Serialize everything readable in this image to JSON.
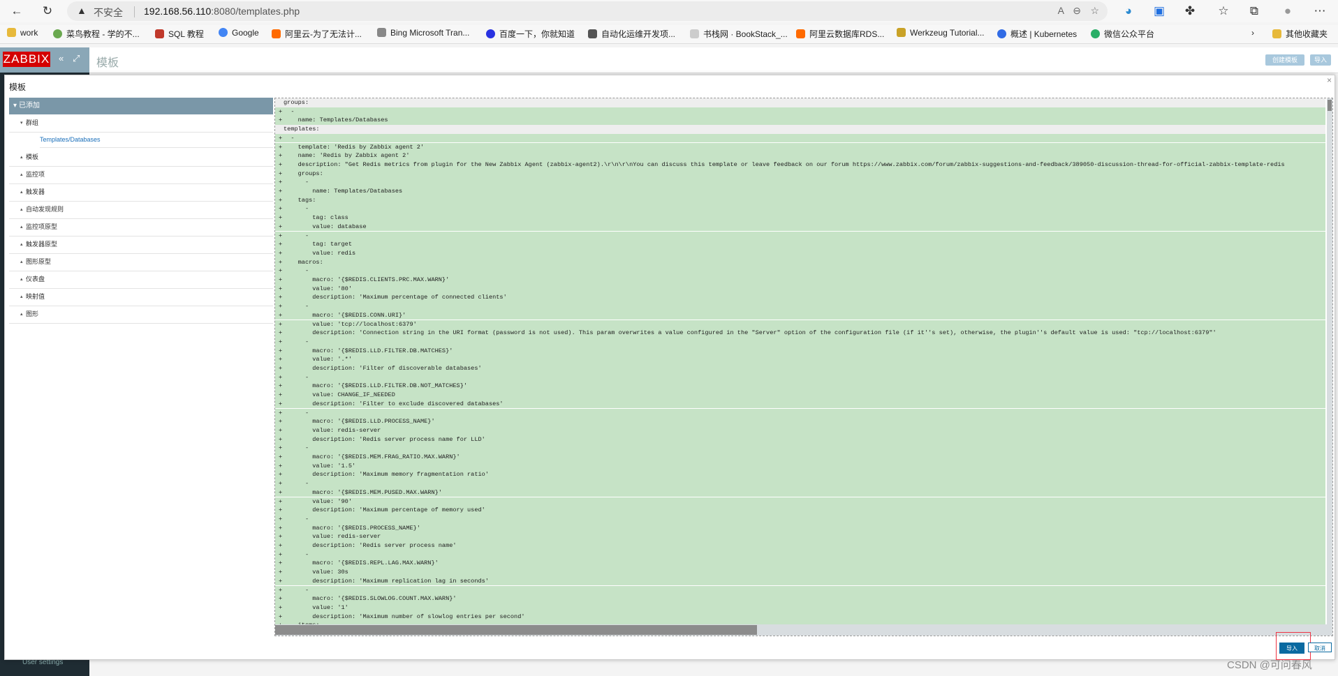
{
  "browser": {
    "security_text": "不安全",
    "url_host": "192.168.56.110",
    "url_rest": ":8080/templates.php",
    "bookmarks": [
      "work",
      "菜鸟教程 - 学的不...",
      "SQL 教程",
      "Google",
      "阿里云-为了无法计...",
      "Bing Microsoft Tran...",
      "百度一下，你就知道",
      "自动化运维开发项...",
      "书栈网 · BookStack_...",
      "阿里云数据库RDS...",
      "Werkzeug Tutorial...",
      "概述 | Kubernetes",
      "微信公众平台"
    ],
    "other_bookmarks": "其他收藏夹",
    "colors": {
      "chrome_bg": "#f7f7f7",
      "addr_bg": "#ececec"
    }
  },
  "app": {
    "logo": "ZABBIX",
    "page_title": "模板",
    "create_template_label": "创建模板",
    "import_label": "导入",
    "user_settings": "User settings",
    "colors": {
      "sidebar": "#1f2c33",
      "logo": "#d40000",
      "primary": "#0a6aa1",
      "tree_head": "#7a97a8",
      "diff_add": "#c6e3c6"
    }
  },
  "modal": {
    "title": "模板",
    "close_icon": "close-icon",
    "tree": {
      "root": "已添加",
      "groups_label": "群组",
      "group_item": "Templates/Databases",
      "categories": [
        "模板",
        "监控项",
        "触发器",
        "自动发现规则",
        "监控项原型",
        "触发器原型",
        "图形原型",
        "仪表盘",
        "映射值",
        "图形"
      ]
    },
    "code_lines": [
      {
        "mark": "",
        "text": "groups:"
      },
      {
        "mark": "+",
        "text": "  -"
      },
      {
        "mark": "+",
        "text": "    name: Templates/Databases"
      },
      {
        "mark": "",
        "text": "templates:"
      },
      {
        "mark": "+",
        "text": "  -"
      },
      {
        "mark": "+",
        "text": "    template: 'Redis by Zabbix agent 2'"
      },
      {
        "mark": "+",
        "text": "    name: 'Redis by Zabbix agent 2'"
      },
      {
        "mark": "+",
        "text": "    description: \"Get Redis metrics from plugin for the New Zabbix Agent (zabbix-agent2).\\r\\n\\r\\nYou can discuss this template or leave feedback on our forum https://www.zabbix.com/forum/zabbix-suggestions-and-feedback/389050-discussion-thread-for-official-zabbix-template-redis"
      },
      {
        "mark": "+",
        "text": "    groups:"
      },
      {
        "mark": "+",
        "text": "      -"
      },
      {
        "mark": "+",
        "text": "        name: Templates/Databases"
      },
      {
        "mark": "+",
        "text": "    tags:"
      },
      {
        "mark": "+",
        "text": "      -"
      },
      {
        "mark": "+",
        "text": "        tag: class"
      },
      {
        "mark": "+",
        "text": "        value: database"
      },
      {
        "mark": "+",
        "text": "      -"
      },
      {
        "mark": "+",
        "text": "        tag: target"
      },
      {
        "mark": "+",
        "text": "        value: redis"
      },
      {
        "mark": "+",
        "text": "    macros:"
      },
      {
        "mark": "+",
        "text": "      -"
      },
      {
        "mark": "+",
        "text": "        macro: '{$REDIS.CLIENTS.PRC.MAX.WARN}'"
      },
      {
        "mark": "+",
        "text": "        value: '80'"
      },
      {
        "mark": "+",
        "text": "        description: 'Maximum percentage of connected clients'"
      },
      {
        "mark": "+",
        "text": "      -"
      },
      {
        "mark": "+",
        "text": "        macro: '{$REDIS.CONN.URI}'"
      },
      {
        "mark": "+",
        "text": "        value: 'tcp://localhost:6379'"
      },
      {
        "mark": "+",
        "text": "        description: 'Connection string in the URI format (password is not used). This param overwrites a value configured in the \"Server\" option of the configuration file (if it''s set), otherwise, the plugin''s default value is used: \"tcp://localhost:6379\"'"
      },
      {
        "mark": "+",
        "text": "      -"
      },
      {
        "mark": "+",
        "text": "        macro: '{$REDIS.LLD.FILTER.DB.MATCHES}'"
      },
      {
        "mark": "+",
        "text": "        value: '.*'"
      },
      {
        "mark": "+",
        "text": "        description: 'Filter of discoverable databases'"
      },
      {
        "mark": "+",
        "text": "      -"
      },
      {
        "mark": "+",
        "text": "        macro: '{$REDIS.LLD.FILTER.DB.NOT_MATCHES}'"
      },
      {
        "mark": "+",
        "text": "        value: CHANGE_IF_NEEDED"
      },
      {
        "mark": "+",
        "text": "        description: 'Filter to exclude discovered databases'"
      },
      {
        "mark": "+",
        "text": "      -"
      },
      {
        "mark": "+",
        "text": "        macro: '{$REDIS.LLD.PROCESS_NAME}'"
      },
      {
        "mark": "+",
        "text": "        value: redis-server"
      },
      {
        "mark": "+",
        "text": "        description: 'Redis server process name for LLD'"
      },
      {
        "mark": "+",
        "text": "      -"
      },
      {
        "mark": "+",
        "text": "        macro: '{$REDIS.MEM.FRAG_RATIO.MAX.WARN}'"
      },
      {
        "mark": "+",
        "text": "        value: '1.5'"
      },
      {
        "mark": "+",
        "text": "        description: 'Maximum memory fragmentation ratio'"
      },
      {
        "mark": "+",
        "text": "      -"
      },
      {
        "mark": "+",
        "text": "        macro: '{$REDIS.MEM.PUSED.MAX.WARN}'"
      },
      {
        "mark": "+",
        "text": "        value: '90'"
      },
      {
        "mark": "+",
        "text": "        description: 'Maximum percentage of memory used'"
      },
      {
        "mark": "+",
        "text": "      -"
      },
      {
        "mark": "+",
        "text": "        macro: '{$REDIS.PROCESS_NAME}'"
      },
      {
        "mark": "+",
        "text": "        value: redis-server"
      },
      {
        "mark": "+",
        "text": "        description: 'Redis server process name'"
      },
      {
        "mark": "+",
        "text": "      -"
      },
      {
        "mark": "+",
        "text": "        macro: '{$REDIS.REPL.LAG.MAX.WARN}'"
      },
      {
        "mark": "+",
        "text": "        value: 30s"
      },
      {
        "mark": "+",
        "text": "        description: 'Maximum replication lag in seconds'"
      },
      {
        "mark": "+",
        "text": "      -"
      },
      {
        "mark": "+",
        "text": "        macro: '{$REDIS.SLOWLOG.COUNT.MAX.WARN}'"
      },
      {
        "mark": "+",
        "text": "        value: '1'"
      },
      {
        "mark": "+",
        "text": "        description: 'Maximum number of slowlog entries per second'"
      },
      {
        "mark": "+",
        "text": "    items:"
      }
    ],
    "import_button": "导入",
    "cancel_button": "取消"
  },
  "watermark": "CSDN @可问春风"
}
